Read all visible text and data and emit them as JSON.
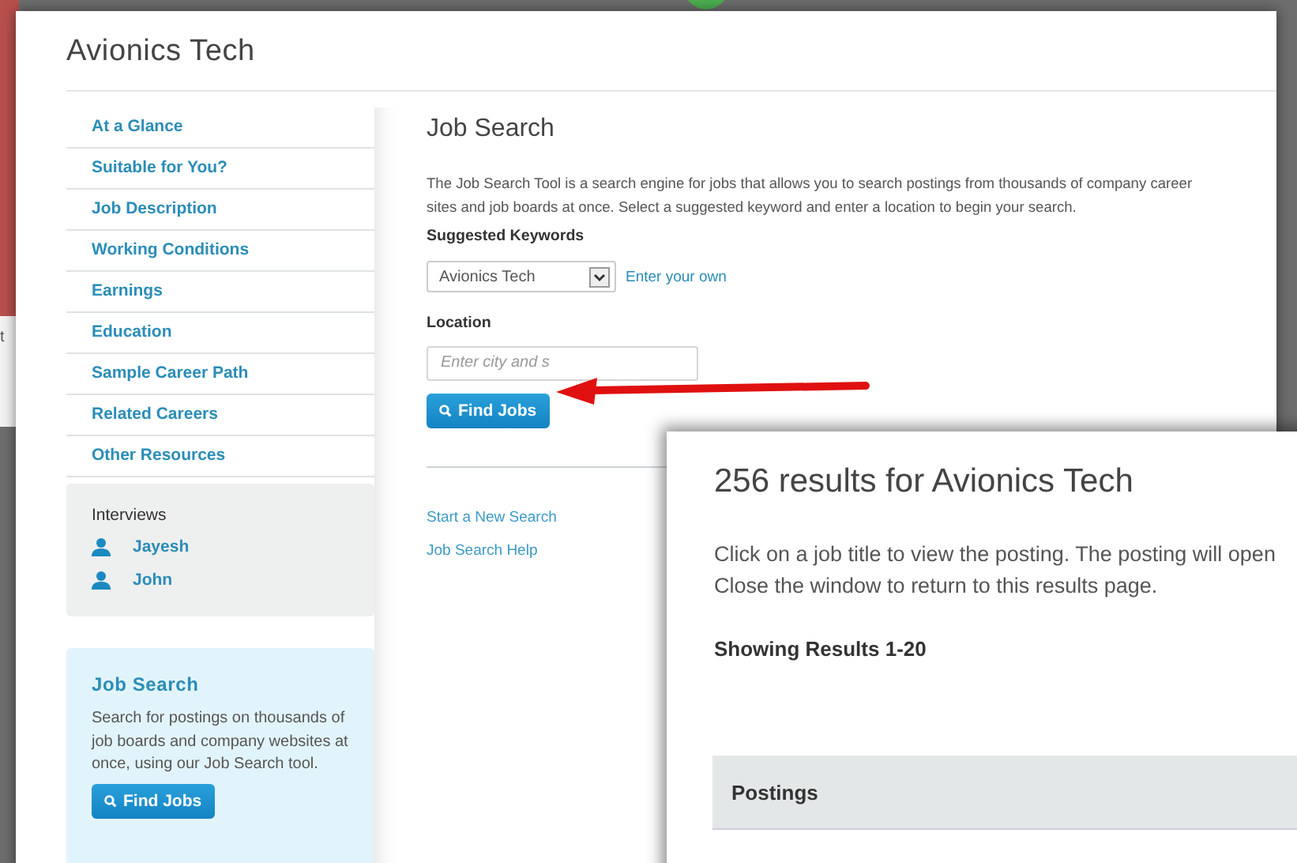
{
  "background_page": {
    "fragment": "t"
  },
  "window": {
    "title": "Avionics Tech"
  },
  "sidebar": {
    "items": [
      {
        "label": "At a Glance"
      },
      {
        "label": "Suitable for You?"
      },
      {
        "label": "Job Description"
      },
      {
        "label": "Working Conditions"
      },
      {
        "label": "Earnings"
      },
      {
        "label": "Education"
      },
      {
        "label": "Sample Career Path"
      },
      {
        "label": "Related Careers"
      },
      {
        "label": "Other Resources"
      }
    ],
    "interviews": {
      "title": "Interviews",
      "people": [
        {
          "name": "Jayesh"
        },
        {
          "name": "John"
        }
      ]
    },
    "job_search": {
      "title": "Job Search",
      "text": "Search for postings on thousands of job boards and company websites at once, using our Job Search tool.",
      "button": "Find Jobs"
    }
  },
  "main": {
    "title": "Job Search",
    "intro": "The Job Search Tool is a search engine for jobs that allows you to search postings from thousands of company career sites and job boards at once. Select a suggested keyword and enter a location to begin your search.",
    "keywords_label": "Suggested Keywords",
    "keyword_value": "Avionics Tech",
    "enter_own": "Enter your own",
    "location_label": "Location",
    "location_placeholder": "Enter city and s",
    "button": "Find Jobs",
    "links": [
      "Start a New Search",
      "Job Search Help"
    ]
  },
  "results": {
    "title": "256 results for Avionics Tech",
    "text": [
      "Click on a job title to view the posting. The posting will open",
      "Close the window to return to this results page."
    ],
    "showing": "Showing Results 1-20",
    "table_header": "Postings"
  }
}
